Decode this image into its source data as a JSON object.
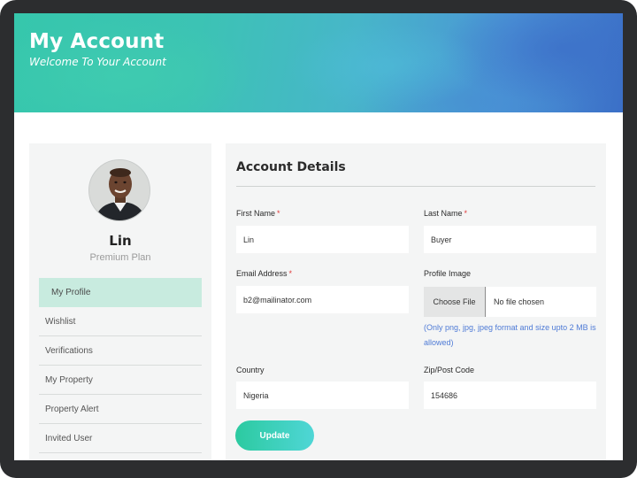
{
  "header": {
    "title": "My Account",
    "subtitle": "Welcome To Your Account"
  },
  "profile": {
    "name": "Lin",
    "plan": "Premium Plan"
  },
  "sidebar": {
    "items": [
      {
        "label": "My Profile",
        "active": true
      },
      {
        "label": "Wishlist",
        "active": false
      },
      {
        "label": "Verifications",
        "active": false
      },
      {
        "label": "My Property",
        "active": false
      },
      {
        "label": "Property Alert",
        "active": false
      },
      {
        "label": "Invited User",
        "active": false
      }
    ]
  },
  "form": {
    "title": "Account Details",
    "required_marker": "*",
    "first_name": {
      "label": "First Name",
      "value": "Lin"
    },
    "last_name": {
      "label": "Last Name",
      "value": "Buyer"
    },
    "email": {
      "label": "Email Address",
      "value": "b2@mailinator.com"
    },
    "profile_image": {
      "label": "Profile Image",
      "button_label": "Choose File",
      "status": "No file chosen",
      "hint": "(Only png, jpg, jpeg format and size upto 2 MB is allowed)"
    },
    "country": {
      "label": "Country",
      "value": "Nigeria"
    },
    "zip": {
      "label": "Zip/Post Code",
      "value": "154686"
    },
    "submit_label": "Update"
  },
  "colors": {
    "accent": "#2ccaa0",
    "active_menu_bg": "#c8ebdf",
    "required": "#e03b3b",
    "hint": "#4f7bd6"
  }
}
